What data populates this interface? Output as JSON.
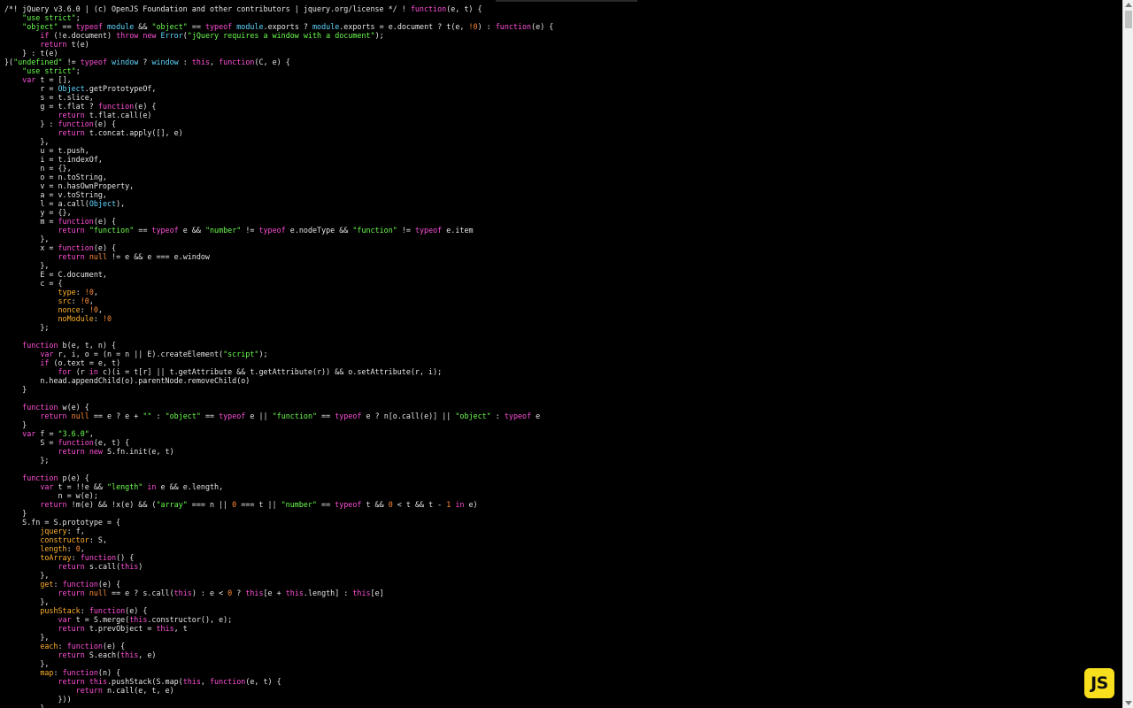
{
  "editor": {
    "token_colors": {
      "keyword": "#ff4fd8",
      "string": "#6cff4f",
      "number": "#ff8c3a",
      "builtin": "#60d6ff",
      "property": "#ffb02e",
      "plain": "#e6e6e6",
      "background": "#000000"
    },
    "lines": [
      [
        [
          "p",
          "/*! jQuery v3.6.0 | (c) OpenJS Foundation and other contributors | jquery.org/license */ ! "
        ],
        [
          "k",
          "function"
        ],
        [
          "p",
          "(e, t) {"
        ]
      ],
      [
        [
          "p",
          "    "
        ],
        [
          "s",
          "\"use strict\""
        ],
        [
          "p",
          ";"
        ]
      ],
      [
        [
          "p",
          "    "
        ],
        [
          "s",
          "\"object\""
        ],
        [
          "p",
          " == "
        ],
        [
          "k",
          "typeof"
        ],
        [
          "p",
          " "
        ],
        [
          "b",
          "module"
        ],
        [
          "p",
          " && "
        ],
        [
          "s",
          "\"object\""
        ],
        [
          "p",
          " == "
        ],
        [
          "k",
          "typeof"
        ],
        [
          "p",
          " "
        ],
        [
          "b",
          "module"
        ],
        [
          "p",
          ".exports ? "
        ],
        [
          "b",
          "module"
        ],
        [
          "p",
          ".exports = e.document ? t(e, "
        ],
        [
          "n",
          "!0"
        ],
        [
          "p",
          ") : "
        ],
        [
          "k",
          "function"
        ],
        [
          "p",
          "(e) {"
        ]
      ],
      [
        [
          "p",
          "        "
        ],
        [
          "k",
          "if"
        ],
        [
          "p",
          " (!e.document) "
        ],
        [
          "k",
          "throw"
        ],
        [
          "p",
          " "
        ],
        [
          "k",
          "new"
        ],
        [
          "p",
          " "
        ],
        [
          "b",
          "Error"
        ],
        [
          "p",
          "("
        ],
        [
          "s",
          "\"jQuery requires a window with a document\""
        ],
        [
          "p",
          ");"
        ]
      ],
      [
        [
          "p",
          "        "
        ],
        [
          "k",
          "return"
        ],
        [
          "p",
          " t(e)"
        ]
      ],
      [
        [
          "p",
          "    } : t(e)"
        ]
      ],
      [
        [
          "p",
          "}("
        ],
        [
          "s",
          "\"undefined\""
        ],
        [
          "p",
          " != "
        ],
        [
          "k",
          "typeof"
        ],
        [
          "p",
          " "
        ],
        [
          "b",
          "window"
        ],
        [
          "p",
          " ? "
        ],
        [
          "b",
          "window"
        ],
        [
          "p",
          " : "
        ],
        [
          "k",
          "this"
        ],
        [
          "p",
          ", "
        ],
        [
          "k",
          "function"
        ],
        [
          "p",
          "(C, e) {"
        ]
      ],
      [
        [
          "p",
          "    "
        ],
        [
          "s",
          "\"use strict\""
        ],
        [
          "p",
          ";"
        ]
      ],
      [
        [
          "p",
          "    "
        ],
        [
          "k",
          "var"
        ],
        [
          "p",
          " t = [],"
        ]
      ],
      [
        [
          "p",
          "        r = "
        ],
        [
          "b",
          "Object"
        ],
        [
          "p",
          ".getPrototypeOf,"
        ]
      ],
      [
        [
          "p",
          "        s = t.slice,"
        ]
      ],
      [
        [
          "p",
          "        g = t.flat ? "
        ],
        [
          "k",
          "function"
        ],
        [
          "p",
          "(e) {"
        ]
      ],
      [
        [
          "p",
          "            "
        ],
        [
          "k",
          "return"
        ],
        [
          "p",
          " t.flat.call(e)"
        ]
      ],
      [
        [
          "p",
          "        } : "
        ],
        [
          "k",
          "function"
        ],
        [
          "p",
          "(e) {"
        ]
      ],
      [
        [
          "p",
          "            "
        ],
        [
          "k",
          "return"
        ],
        [
          "p",
          " t.concat.apply([], e)"
        ]
      ],
      [
        [
          "p",
          "        },"
        ]
      ],
      [
        [
          "p",
          "        u = t.push,"
        ]
      ],
      [
        [
          "p",
          "        i = t.indexOf,"
        ]
      ],
      [
        [
          "p",
          "        n = {},"
        ]
      ],
      [
        [
          "p",
          "        o = n.toString,"
        ]
      ],
      [
        [
          "p",
          "        v = n.hasOwnProperty,"
        ]
      ],
      [
        [
          "p",
          "        a = v.toString,"
        ]
      ],
      [
        [
          "p",
          "        l = a.call("
        ],
        [
          "b",
          "Object"
        ],
        [
          "p",
          "),"
        ]
      ],
      [
        [
          "p",
          "        y = {},"
        ]
      ],
      [
        [
          "p",
          "        m = "
        ],
        [
          "k",
          "function"
        ],
        [
          "p",
          "(e) {"
        ]
      ],
      [
        [
          "p",
          "            "
        ],
        [
          "k",
          "return"
        ],
        [
          "p",
          " "
        ],
        [
          "s",
          "\"function\""
        ],
        [
          "p",
          " == "
        ],
        [
          "k",
          "typeof"
        ],
        [
          "p",
          " e && "
        ],
        [
          "s",
          "\"number\""
        ],
        [
          "p",
          " != "
        ],
        [
          "k",
          "typeof"
        ],
        [
          "p",
          " e.nodeType && "
        ],
        [
          "s",
          "\"function\""
        ],
        [
          "p",
          " != "
        ],
        [
          "k",
          "typeof"
        ],
        [
          "p",
          " e.item"
        ]
      ],
      [
        [
          "p",
          "        },"
        ]
      ],
      [
        [
          "p",
          "        x = "
        ],
        [
          "k",
          "function"
        ],
        [
          "p",
          "(e) {"
        ]
      ],
      [
        [
          "p",
          "            "
        ],
        [
          "k",
          "return"
        ],
        [
          "p",
          " "
        ],
        [
          "n",
          "null"
        ],
        [
          "p",
          " != e && e === e.window"
        ]
      ],
      [
        [
          "p",
          "        },"
        ]
      ],
      [
        [
          "p",
          "        E = C.document,"
        ]
      ],
      [
        [
          "p",
          "        c = {"
        ]
      ],
      [
        [
          "p",
          "            "
        ],
        [
          "y",
          "type"
        ],
        [
          "p",
          ": "
        ],
        [
          "n",
          "!0"
        ],
        [
          "p",
          ","
        ]
      ],
      [
        [
          "p",
          "            "
        ],
        [
          "y",
          "src"
        ],
        [
          "p",
          ": "
        ],
        [
          "n",
          "!0"
        ],
        [
          "p",
          ","
        ]
      ],
      [
        [
          "p",
          "            "
        ],
        [
          "y",
          "nonce"
        ],
        [
          "p",
          ": "
        ],
        [
          "n",
          "!0"
        ],
        [
          "p",
          ","
        ]
      ],
      [
        [
          "p",
          "            "
        ],
        [
          "y",
          "noModule"
        ],
        [
          "p",
          ": "
        ],
        [
          "n",
          "!0"
        ]
      ],
      [
        [
          "p",
          "        };"
        ]
      ],
      [
        [
          "p",
          ""
        ]
      ],
      [
        [
          "p",
          "    "
        ],
        [
          "k",
          "function"
        ],
        [
          "p",
          " b(e, t, n) {"
        ]
      ],
      [
        [
          "p",
          "        "
        ],
        [
          "k",
          "var"
        ],
        [
          "p",
          " r, i, o = (n = n || E).createElement("
        ],
        [
          "s",
          "\"script\""
        ],
        [
          "p",
          ");"
        ]
      ],
      [
        [
          "p",
          "        "
        ],
        [
          "k",
          "if"
        ],
        [
          "p",
          " (o.text = e, t)"
        ]
      ],
      [
        [
          "p",
          "            "
        ],
        [
          "k",
          "for"
        ],
        [
          "p",
          " (r "
        ],
        [
          "k",
          "in"
        ],
        [
          "p",
          " c)(i = t[r] || t.getAttribute && t.getAttribute(r)) && o.setAttribute(r, i);"
        ]
      ],
      [
        [
          "p",
          "        n.head.appendChild(o).parentNode.removeChild(o)"
        ]
      ],
      [
        [
          "p",
          "    }"
        ]
      ],
      [
        [
          "p",
          ""
        ]
      ],
      [
        [
          "p",
          "    "
        ],
        [
          "k",
          "function"
        ],
        [
          "p",
          " w(e) {"
        ]
      ],
      [
        [
          "p",
          "        "
        ],
        [
          "k",
          "return"
        ],
        [
          "p",
          " "
        ],
        [
          "n",
          "null"
        ],
        [
          "p",
          " == e ? e + "
        ],
        [
          "s",
          "\"\""
        ],
        [
          "p",
          " : "
        ],
        [
          "s",
          "\"object\""
        ],
        [
          "p",
          " == "
        ],
        [
          "k",
          "typeof"
        ],
        [
          "p",
          " e || "
        ],
        [
          "s",
          "\"function\""
        ],
        [
          "p",
          " == "
        ],
        [
          "k",
          "typeof"
        ],
        [
          "p",
          " e ? n[o.call(e)] || "
        ],
        [
          "s",
          "\"object\""
        ],
        [
          "p",
          " : "
        ],
        [
          "k",
          "typeof"
        ],
        [
          "p",
          " e"
        ]
      ],
      [
        [
          "p",
          "    }"
        ]
      ],
      [
        [
          "p",
          "    "
        ],
        [
          "k",
          "var"
        ],
        [
          "p",
          " f = "
        ],
        [
          "s",
          "\"3.6.0\""
        ],
        [
          "p",
          ","
        ]
      ],
      [
        [
          "p",
          "        S = "
        ],
        [
          "k",
          "function"
        ],
        [
          "p",
          "(e, t) {"
        ]
      ],
      [
        [
          "p",
          "            "
        ],
        [
          "k",
          "return"
        ],
        [
          "p",
          " "
        ],
        [
          "k",
          "new"
        ],
        [
          "p",
          " S.fn.init(e, t)"
        ]
      ],
      [
        [
          "p",
          "        };"
        ]
      ],
      [
        [
          "p",
          ""
        ]
      ],
      [
        [
          "p",
          "    "
        ],
        [
          "k",
          "function"
        ],
        [
          "p",
          " p(e) {"
        ]
      ],
      [
        [
          "p",
          "        "
        ],
        [
          "k",
          "var"
        ],
        [
          "p",
          " t = !!e && "
        ],
        [
          "s",
          "\"length\""
        ],
        [
          "p",
          " "
        ],
        [
          "k",
          "in"
        ],
        [
          "p",
          " e && e.length,"
        ]
      ],
      [
        [
          "p",
          "            n = w(e);"
        ]
      ],
      [
        [
          "p",
          "        "
        ],
        [
          "k",
          "return"
        ],
        [
          "p",
          " !m(e) && !x(e) && ("
        ],
        [
          "s",
          "\"array\""
        ],
        [
          "p",
          " === n || "
        ],
        [
          "n",
          "0"
        ],
        [
          "p",
          " === t || "
        ],
        [
          "s",
          "\"number\""
        ],
        [
          "p",
          " == "
        ],
        [
          "k",
          "typeof"
        ],
        [
          "p",
          " t && "
        ],
        [
          "n",
          "0"
        ],
        [
          "p",
          " < t && t - "
        ],
        [
          "n",
          "1"
        ],
        [
          "p",
          " "
        ],
        [
          "k",
          "in"
        ],
        [
          "p",
          " e)"
        ]
      ],
      [
        [
          "p",
          "    }"
        ]
      ],
      [
        [
          "p",
          "    S.fn = S.prototype = {"
        ]
      ],
      [
        [
          "p",
          "        "
        ],
        [
          "y",
          "jquery"
        ],
        [
          "p",
          ": f,"
        ]
      ],
      [
        [
          "p",
          "        "
        ],
        [
          "y",
          "constructor"
        ],
        [
          "p",
          ": S,"
        ]
      ],
      [
        [
          "p",
          "        "
        ],
        [
          "y",
          "length"
        ],
        [
          "p",
          ": "
        ],
        [
          "n",
          "0"
        ],
        [
          "p",
          ","
        ]
      ],
      [
        [
          "p",
          "        "
        ],
        [
          "y",
          "toArray"
        ],
        [
          "p",
          ": "
        ],
        [
          "k",
          "function"
        ],
        [
          "p",
          "() {"
        ]
      ],
      [
        [
          "p",
          "            "
        ],
        [
          "k",
          "return"
        ],
        [
          "p",
          " s.call("
        ],
        [
          "k",
          "this"
        ],
        [
          "p",
          ")"
        ]
      ],
      [
        [
          "p",
          "        },"
        ]
      ],
      [
        [
          "p",
          "        "
        ],
        [
          "y",
          "get"
        ],
        [
          "p",
          ": "
        ],
        [
          "k",
          "function"
        ],
        [
          "p",
          "(e) {"
        ]
      ],
      [
        [
          "p",
          "            "
        ],
        [
          "k",
          "return"
        ],
        [
          "p",
          " "
        ],
        [
          "n",
          "null"
        ],
        [
          "p",
          " == e ? s.call("
        ],
        [
          "k",
          "this"
        ],
        [
          "p",
          ") : e < "
        ],
        [
          "n",
          "0"
        ],
        [
          "p",
          " ? "
        ],
        [
          "k",
          "this"
        ],
        [
          "p",
          "[e + "
        ],
        [
          "k",
          "this"
        ],
        [
          "p",
          ".length] : "
        ],
        [
          "k",
          "this"
        ],
        [
          "p",
          "[e]"
        ]
      ],
      [
        [
          "p",
          "        },"
        ]
      ],
      [
        [
          "p",
          "        "
        ],
        [
          "y",
          "pushStack"
        ],
        [
          "p",
          ": "
        ],
        [
          "k",
          "function"
        ],
        [
          "p",
          "(e) {"
        ]
      ],
      [
        [
          "p",
          "            "
        ],
        [
          "k",
          "var"
        ],
        [
          "p",
          " t = S.merge("
        ],
        [
          "k",
          "this"
        ],
        [
          "p",
          ".constructor(), e);"
        ]
      ],
      [
        [
          "p",
          "            "
        ],
        [
          "k",
          "return"
        ],
        [
          "p",
          " t.prevObject = "
        ],
        [
          "k",
          "this"
        ],
        [
          "p",
          ", t"
        ]
      ],
      [
        [
          "p",
          "        },"
        ]
      ],
      [
        [
          "p",
          "        "
        ],
        [
          "y",
          "each"
        ],
        [
          "p",
          ": "
        ],
        [
          "k",
          "function"
        ],
        [
          "p",
          "(e) {"
        ]
      ],
      [
        [
          "p",
          "            "
        ],
        [
          "k",
          "return"
        ],
        [
          "p",
          " S.each("
        ],
        [
          "k",
          "this"
        ],
        [
          "p",
          ", e)"
        ]
      ],
      [
        [
          "p",
          "        },"
        ]
      ],
      [
        [
          "p",
          "        "
        ],
        [
          "y",
          "map"
        ],
        [
          "p",
          ": "
        ],
        [
          "k",
          "function"
        ],
        [
          "p",
          "(n) {"
        ]
      ],
      [
        [
          "p",
          "            "
        ],
        [
          "k",
          "return"
        ],
        [
          "p",
          " "
        ],
        [
          "k",
          "this"
        ],
        [
          "p",
          ".pushStack(S.map("
        ],
        [
          "k",
          "this"
        ],
        [
          "p",
          ", "
        ],
        [
          "k",
          "function"
        ],
        [
          "p",
          "(e, t) {"
        ]
      ],
      [
        [
          "p",
          "                "
        ],
        [
          "k",
          "return"
        ],
        [
          "p",
          " n.call(e, t, e)"
        ]
      ],
      [
        [
          "p",
          "            }))"
        ]
      ],
      [
        [
          "p",
          "        },"
        ]
      ]
    ]
  },
  "badge": {
    "label": "JS",
    "color": "#f7df1e"
  },
  "scrollbar": {
    "up_icon": "arrow-up-icon",
    "down_icon": "arrow-down-icon"
  }
}
